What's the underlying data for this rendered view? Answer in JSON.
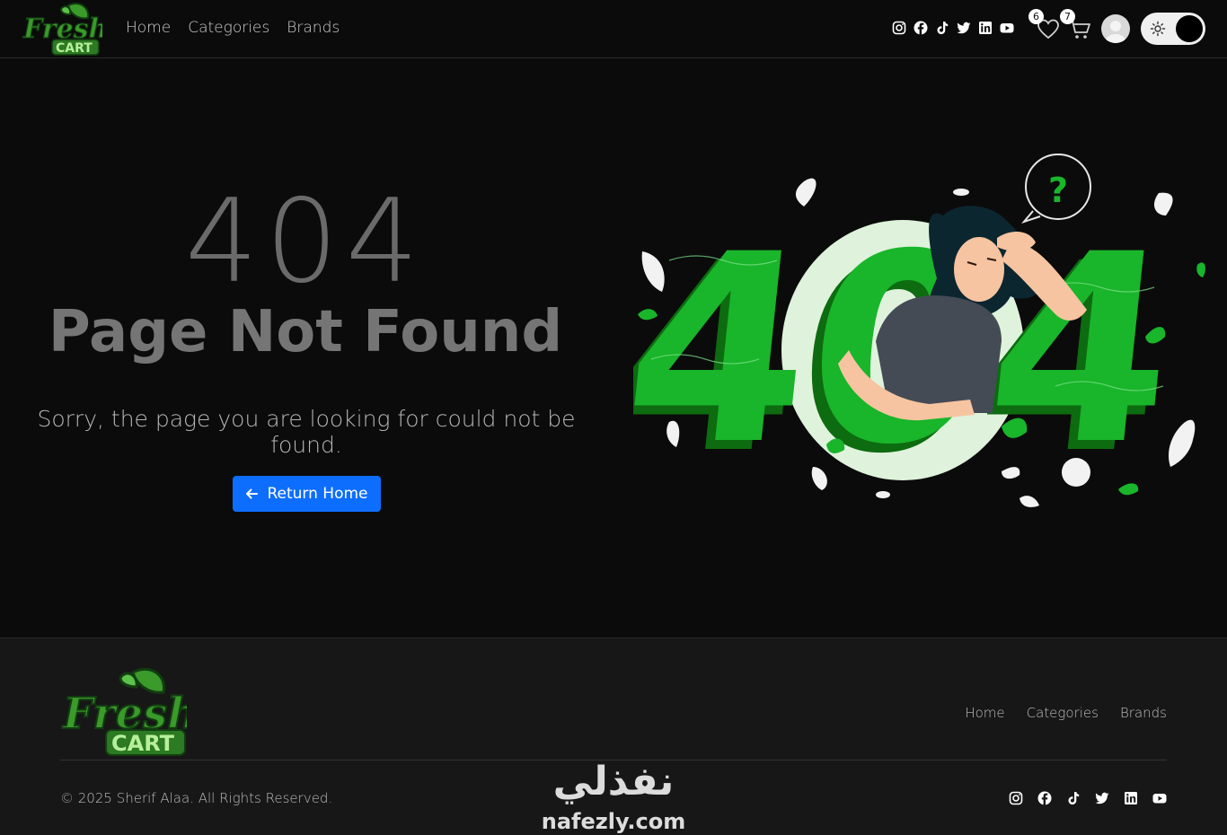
{
  "brand": {
    "logo_word1": "Fresh",
    "logo_word2": "CART",
    "green": "#3a9a2a",
    "dark_green": "#1e5a18"
  },
  "nav": {
    "links": [
      "Home",
      "Categories",
      "Brands"
    ],
    "social_icons": [
      "instagram-icon",
      "facebook-icon",
      "tiktok-icon",
      "twitter-icon",
      "linkedin-icon",
      "youtube-icon"
    ],
    "wishlist_count": "6",
    "cart_count": "7"
  },
  "main": {
    "code": "404",
    "title": "Page Not Found",
    "message": "Sorry, the page you are looking for could not be found.",
    "button_label": "Return Home",
    "button_color": "#0d6efd",
    "illustration_text": "404",
    "question_mark": "?"
  },
  "footer": {
    "links": [
      "Home",
      "Categories",
      "Brands"
    ],
    "copyright": "© 2025 Sherif Alaa. All Rights Reserved.",
    "social_icons": [
      "instagram-icon",
      "facebook-icon",
      "tiktok-icon",
      "twitter-icon",
      "linkedin-icon",
      "youtube-icon"
    ]
  },
  "watermark": {
    "arabic": "نفذلي",
    "latin": "nafezly.com"
  }
}
